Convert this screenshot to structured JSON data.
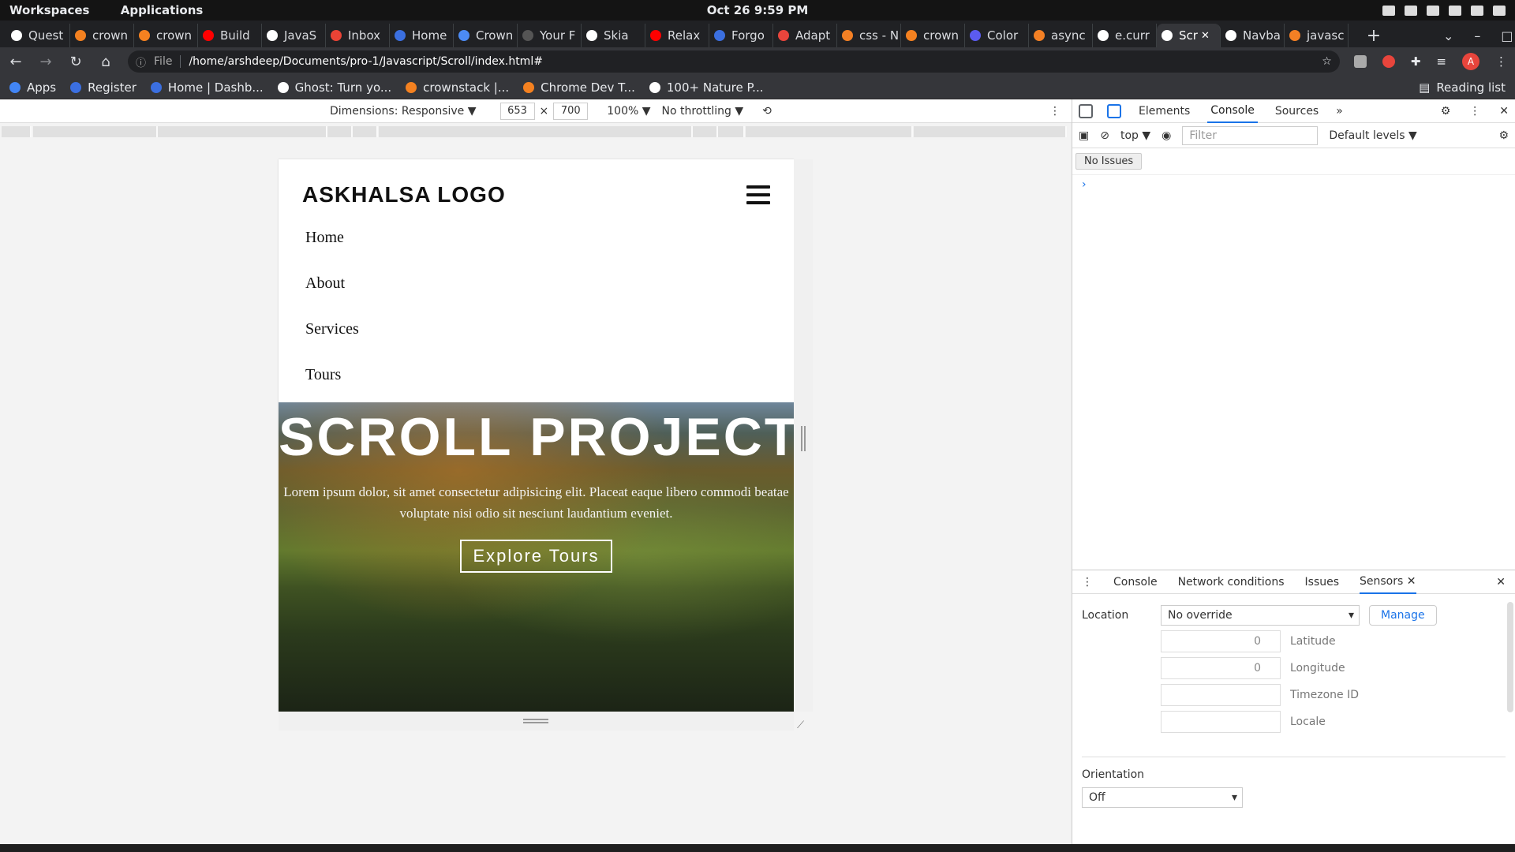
{
  "system": {
    "workspaces": "Workspaces",
    "applications": "Applications",
    "clock": "Oct 26   9:59 PM"
  },
  "tabs": [
    {
      "title": "Quest",
      "color": "#ffffff"
    },
    {
      "title": "crown",
      "color": "#f48120"
    },
    {
      "title": "crown",
      "color": "#f48120"
    },
    {
      "title": "Build",
      "color": "#ff0000"
    },
    {
      "title": "JavaS",
      "color": "#ffffff"
    },
    {
      "title": "Inbox",
      "color": "#ea4335"
    },
    {
      "title": "Home",
      "color": "#3b6fe0"
    },
    {
      "title": "Crown",
      "color": "#4c8bf5"
    },
    {
      "title": "Your F",
      "color": "#555555"
    },
    {
      "title": "Skia",
      "color": "#ffffff"
    },
    {
      "title": "Relax",
      "color": "#ff0000"
    },
    {
      "title": "Forgo",
      "color": "#3b6fe0"
    },
    {
      "title": "Adapt",
      "color": "#e8453c"
    },
    {
      "title": "css - N",
      "color": "#f48024"
    },
    {
      "title": "crown",
      "color": "#f48120"
    },
    {
      "title": "Color",
      "color": "#5b5bf0"
    },
    {
      "title": "async",
      "color": "#f48024"
    },
    {
      "title": "e.curr",
      "color": "#ffffff"
    },
    {
      "title": "Scr",
      "color": "#ffffff",
      "active": true
    },
    {
      "title": "Navba",
      "color": "#ffffff"
    },
    {
      "title": "javasc",
      "color": "#f48024"
    }
  ],
  "address": {
    "scheme": "File",
    "url": "/home/arshdeep/Documents/pro-1/Javascript/Scroll/index.html#",
    "avatar": "A"
  },
  "bookmarks": [
    {
      "label": "Apps",
      "color": "#4285f4"
    },
    {
      "label": "Register",
      "color": "#3b6fe0"
    },
    {
      "label": "Home | Dashb...",
      "color": "#3b6fe0"
    },
    {
      "label": "Ghost: Turn yo...",
      "color": "#ffffff"
    },
    {
      "label": "crownstack |...",
      "color": "#f48120"
    },
    {
      "label": "Chrome Dev T...",
      "color": "#f48120"
    },
    {
      "label": "100+ Nature P...",
      "color": "#ffffff"
    }
  ],
  "reading_list": "Reading list",
  "device_toolbar": {
    "dimensions": "Dimensions: Responsive ▼",
    "width": "653",
    "times": "×",
    "height": "700",
    "zoom": "100% ▼",
    "throttling": "No throttling ▼"
  },
  "site": {
    "logo": "ASKHALSA LOGO",
    "links": [
      "Home",
      "About",
      "Services",
      "Tours"
    ],
    "hero_title": "SCROLL PROJECT",
    "hero_text": "Lorem ipsum dolor, sit amet consectetur adipisicing elit. Placeat eaque libero commodi beatae voluptate nisi odio sit nesciunt laudantium eveniet.",
    "cta": "Explore Tours"
  },
  "devtools": {
    "tabs": [
      "Elements",
      "Console",
      "Sources"
    ],
    "active_tab": "Console",
    "context": "top ▼",
    "filter_placeholder": "Filter",
    "levels": "Default levels ▼",
    "issues": "No Issues",
    "drawer_tabs": [
      "Console",
      "Network conditions",
      "Issues",
      "Sensors"
    ],
    "sensors": {
      "location_label": "Location",
      "location_value": "No override",
      "manage": "Manage",
      "latitude_value": "0",
      "latitude_label": "Latitude",
      "longitude_value": "0",
      "longitude_label": "Longitude",
      "timezone_label": "Timezone ID",
      "locale_label": "Locale",
      "orientation_label": "Orientation",
      "orientation_value": "Off"
    }
  }
}
